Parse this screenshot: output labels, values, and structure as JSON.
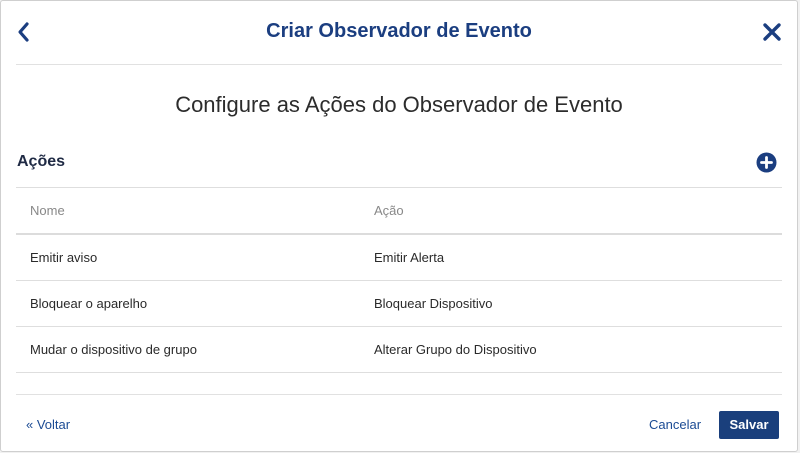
{
  "header": {
    "title": "Criar Observador de Evento"
  },
  "subtitle": "Configure as Ações do Observador de Evento",
  "actions_section": {
    "title": "Ações",
    "columns": [
      "Nome",
      "Ação"
    ],
    "rows": [
      {
        "name": "Emitir aviso",
        "action": "Emitir Alerta"
      },
      {
        "name": "Bloquear o aparelho",
        "action": "Bloquear Dispositivo"
      },
      {
        "name": "Mudar o dispositivo de grupo",
        "action": "Alterar Grupo do Dispositivo"
      }
    ]
  },
  "footer": {
    "back_label": "« Voltar",
    "cancel_label": "Cancelar",
    "save_label": "Salvar"
  },
  "colors": {
    "brand": "#1b3e80",
    "save_button_bg": "#1a3f7c"
  },
  "icons": {
    "back": "chevron-left-icon",
    "close": "close-icon",
    "add": "plus-circle-icon"
  }
}
